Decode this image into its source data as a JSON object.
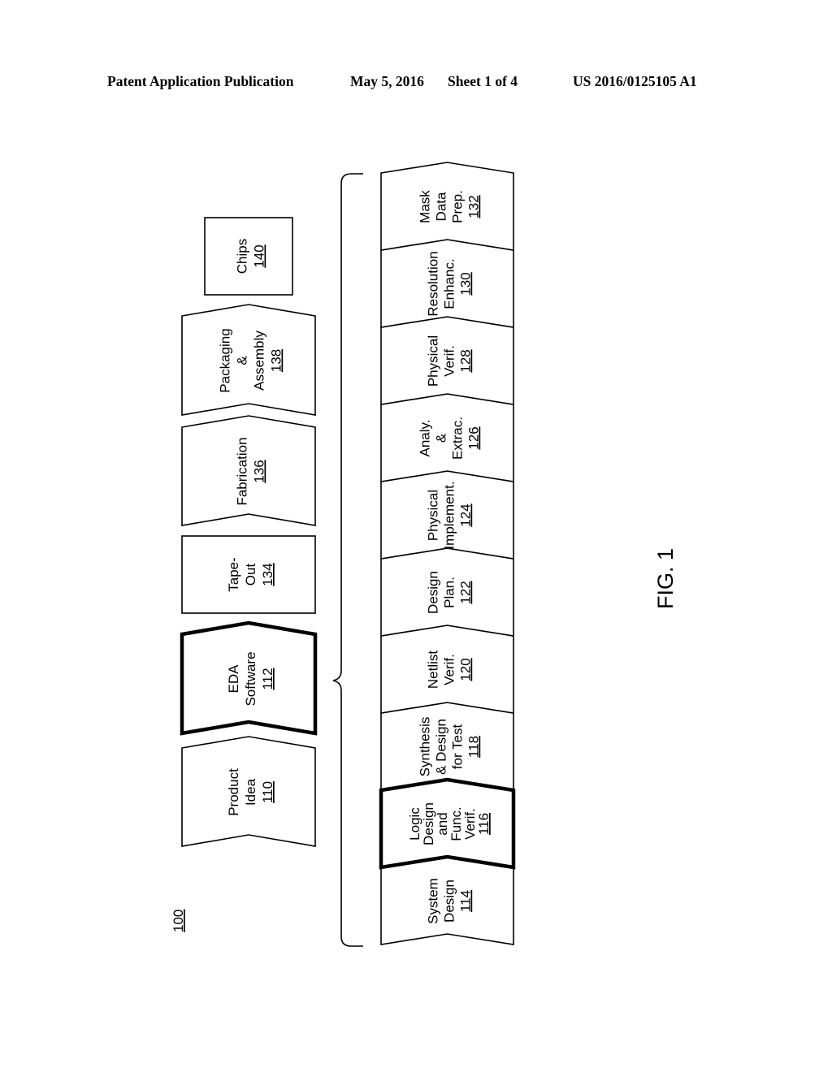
{
  "header": {
    "publication": "Patent Application Publication",
    "date": "May 5, 2016",
    "sheet": "Sheet 1 of 4",
    "number": "US 2016/0125105 A1"
  },
  "figure": {
    "label": "FIG. 1",
    "reference": "100"
  },
  "top_flow": [
    {
      "lines": [
        "Product",
        "Idea"
      ],
      "ref": "110",
      "shape": "chevron",
      "emphasized": false
    },
    {
      "lines": [
        "EDA",
        "Software"
      ],
      "ref": "112",
      "shape": "chevron",
      "emphasized": true
    },
    {
      "lines": [
        "Tape-",
        "Out"
      ],
      "ref": "134",
      "shape": "rectangle",
      "emphasized": false
    },
    {
      "lines": [
        "Fabrication"
      ],
      "ref": "136",
      "shape": "chevron",
      "emphasized": false
    },
    {
      "lines": [
        "Packaging",
        "&",
        "Assembly"
      ],
      "ref": "138",
      "shape": "chevron",
      "emphasized": false
    },
    {
      "lines": [
        "Chips"
      ],
      "ref": "140",
      "shape": "rectangle",
      "emphasized": false
    }
  ],
  "eda_steps": [
    {
      "lines": [
        "System",
        "Design"
      ],
      "ref": "114",
      "emphasized": false
    },
    {
      "lines": [
        "Logic",
        "Design",
        "and",
        "Func.",
        "Verif."
      ],
      "ref": "116",
      "emphasized": true
    },
    {
      "lines": [
        "Synthesis",
        "& Design",
        "for Test"
      ],
      "ref": "118",
      "emphasized": false
    },
    {
      "lines": [
        "Netlist",
        "Verif."
      ],
      "ref": "120",
      "emphasized": false
    },
    {
      "lines": [
        "Design",
        "Plan."
      ],
      "ref": "122",
      "emphasized": false
    },
    {
      "lines": [
        "Physical",
        "Implement."
      ],
      "ref": "124",
      "emphasized": false
    },
    {
      "lines": [
        "Analy.",
        "&",
        "Extrac."
      ],
      "ref": "126",
      "emphasized": false
    },
    {
      "lines": [
        "Physical",
        "Verif."
      ],
      "ref": "128",
      "emphasized": false
    },
    {
      "lines": [
        "Resolution",
        "Enhanc."
      ],
      "ref": "130",
      "emphasized": false
    },
    {
      "lines": [
        "Mask",
        "Data",
        "Prep."
      ],
      "ref": "132",
      "emphasized": false
    }
  ]
}
